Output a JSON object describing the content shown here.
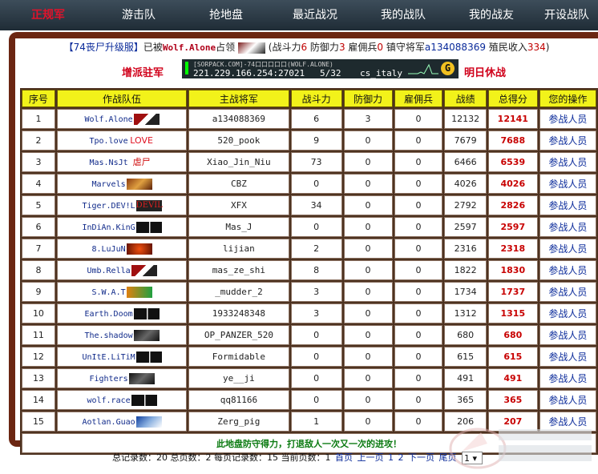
{
  "nav": {
    "items": [
      "正规军",
      "游击队",
      "抢地盘",
      "最近战况",
      "我的战队",
      "我的战友",
      "开设战队"
    ]
  },
  "status": {
    "server": "【74丧尸升级服】",
    "occupied": "已被",
    "team": "Wolf.Alone",
    "occupied_suffix": "占领",
    "power_label": "(战斗力",
    "power": "6",
    "defense_label": "防御力",
    "defense": "3",
    "merc_label": "雇佣兵",
    "merc": "0",
    "general_label": "镇守将军",
    "general": "a134088369",
    "income_label": "殖民收入",
    "income": "334",
    "close": ")"
  },
  "actions": {
    "send_label": "增派驻军",
    "tomorrow_label": "明日休战"
  },
  "banner": {
    "site": "[SORPACK.COM]-74口口口口口(WOLF.ALONE)",
    "ip": "221.229.166.254:27021",
    "players": "5/32",
    "map": "cs_italy"
  },
  "table": {
    "headers": [
      "序号",
      "作战队伍",
      "主战将军",
      "战斗力",
      "防御力",
      "雇佣兵",
      "战绩",
      "总得分",
      "您的操作"
    ],
    "rows": [
      {
        "no": "1",
        "team": "Wolf.Alone",
        "general": "a134088369",
        "power": "6",
        "defense": "3",
        "merc": "0",
        "record": "12132",
        "score": "12141",
        "op": "参战人员",
        "logo": "flag-red"
      },
      {
        "no": "2",
        "team": "Tpo.love",
        "general": "520_pook",
        "power": "9",
        "defense": "0",
        "merc": "0",
        "record": "7679",
        "score": "7688",
        "op": "参战人员",
        "logo": "love"
      },
      {
        "no": "3",
        "team": "Mas.NsJt",
        "general": "Xiao_Jin_Niu",
        "power": "73",
        "defense": "0",
        "merc": "0",
        "record": "6466",
        "score": "6539",
        "op": "参战人员",
        "logo": "text-red"
      },
      {
        "no": "4",
        "team": "Marvels",
        "general": "CBZ",
        "power": "0",
        "defense": "0",
        "merc": "0",
        "record": "4026",
        "score": "4026",
        "op": "参战人员",
        "logo": "brown"
      },
      {
        "no": "5",
        "team": "Tiger.DEV!L",
        "general": "XFX",
        "power": "34",
        "defense": "0",
        "merc": "0",
        "record": "2792",
        "score": "2826",
        "op": "参战人员",
        "logo": "devil"
      },
      {
        "no": "6",
        "team": "InDiAn.KinG",
        "general": "Mas_J",
        "power": "0",
        "defense": "0",
        "merc": "0",
        "record": "2597",
        "score": "2597",
        "op": "参战人员",
        "logo": "skull"
      },
      {
        "no": "7",
        "team": "8.LuJuN",
        "general": "lijian",
        "power": "2",
        "defense": "0",
        "merc": "0",
        "record": "2316",
        "score": "2318",
        "op": "参战人员",
        "logo": "orange"
      },
      {
        "no": "8",
        "team": "Umb.Rella",
        "general": "mas_ze_shi",
        "power": "8",
        "defense": "0",
        "merc": "0",
        "record": "1822",
        "score": "1830",
        "op": "参战人员",
        "logo": "flag-red"
      },
      {
        "no": "9",
        "team": "S.W.A.T",
        "general": "_mudder_2",
        "power": "3",
        "defense": "0",
        "merc": "0",
        "record": "1734",
        "score": "1737",
        "op": "参战人员",
        "logo": "india"
      },
      {
        "no": "10",
        "team": "Earth.Doom",
        "general": "1933248348",
        "power": "3",
        "defense": "0",
        "merc": "0",
        "record": "1312",
        "score": "1315",
        "op": "参战人员",
        "logo": "skull"
      },
      {
        "no": "11",
        "team": "The.shadow",
        "general": "OP_PANZER_520",
        "power": "0",
        "defense": "0",
        "merc": "0",
        "record": "680",
        "score": "680",
        "op": "参战人员",
        "logo": "dark"
      },
      {
        "no": "12",
        "team": "UnItE.LiTiM",
        "general": "Formidable",
        "power": "0",
        "defense": "0",
        "merc": "0",
        "record": "615",
        "score": "615",
        "op": "参战人员",
        "logo": "skull"
      },
      {
        "no": "13",
        "team": "Fighters",
        "general": "ye__ji",
        "power": "0",
        "defense": "0",
        "merc": "0",
        "record": "491",
        "score": "491",
        "op": "参战人员",
        "logo": "dark"
      },
      {
        "no": "14",
        "team": "wolf.race",
        "general": "qq81166",
        "power": "0",
        "defense": "0",
        "merc": "0",
        "record": "365",
        "score": "365",
        "op": "参战人员",
        "logo": "skull"
      },
      {
        "no": "15",
        "team": "Aotlan.Guao",
        "general": "Zerg_pig",
        "power": "1",
        "defense": "0",
        "merc": "0",
        "record": "206",
        "score": "207",
        "op": "参战人员",
        "logo": "blue"
      }
    ],
    "footer": "此地盘防守得力，打退敌人一次又一次的进攻！"
  },
  "pager": {
    "total_label": "总记录数：",
    "total": "20",
    "pages_label": "总页数：",
    "pages": "2",
    "per_label": "每页记录数：",
    "per": "15",
    "current_label": "当前页数：",
    "current": "1",
    "first": "首页",
    "prev": "上一页",
    "p1": "1",
    "p2": "2",
    "next": "下一页",
    "last": "尾页",
    "select_value": "1"
  },
  "colors": {
    "nav_bg": "#1f2c36",
    "nav_active": "#e2122b",
    "frame": "#6b2612",
    "header_yellow": "#f2f21a",
    "score_red": "#c80000",
    "link_blue": "#0a2a9a",
    "footer_green": "#0a7a10"
  }
}
